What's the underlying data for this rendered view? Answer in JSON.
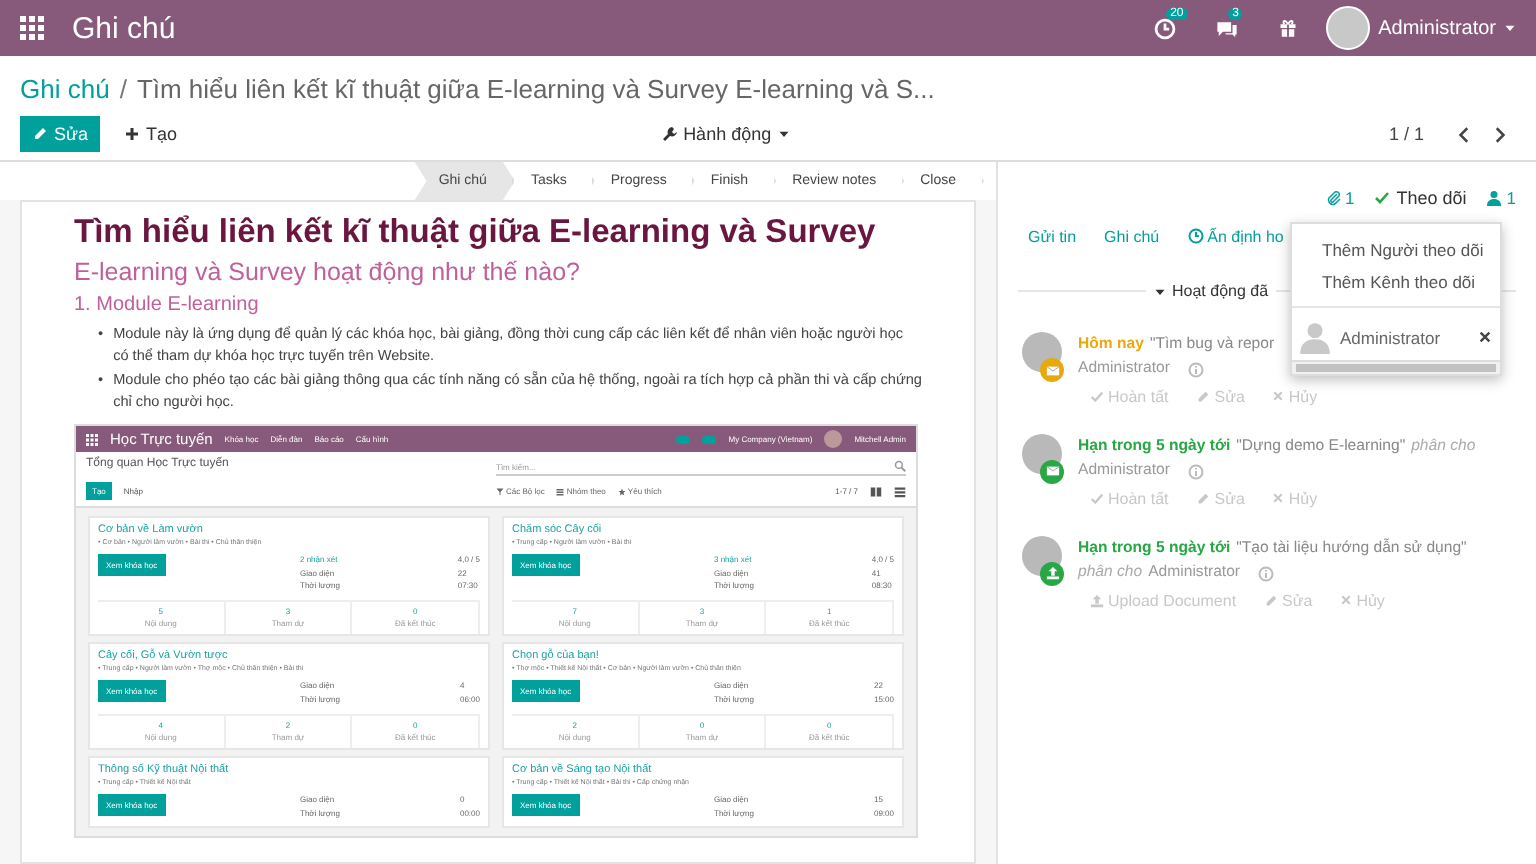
{
  "topbar": {
    "app_title": "Ghi chú",
    "activity_count": "20",
    "message_count": "3",
    "user": "Administrator"
  },
  "breadcrumb": {
    "parent": "Ghi chú",
    "separator": "/",
    "current": "Tìm hiểu liên kết kĩ thuật giữa E-learning và Survey E-learning và S..."
  },
  "toolbar": {
    "edit": "Sửa",
    "create": "Tạo",
    "action": "Hành động",
    "pager": "1 / 1"
  },
  "stages": [
    {
      "label": "Ghi chú",
      "selected": true
    },
    {
      "label": "Tasks",
      "selected": false
    },
    {
      "label": "Progress",
      "selected": false
    },
    {
      "label": "Finish",
      "selected": false
    },
    {
      "label": "Review notes",
      "selected": false
    },
    {
      "label": "Close",
      "selected": false
    }
  ],
  "document": {
    "title": "Tìm hiểu liên kết kĩ thuật giữa E-learning và Survey",
    "subtitle": "E-learning và Survey hoạt động như thế nào?",
    "section": "1. Module E-learning",
    "bullets": [
      {
        "marker": "•",
        "text": "Module này là ứng dụng để quản lý các khóa học, bài giảng, đồng thời cung cấp các liên kết để nhân viên hoặc người học có thể tham dự khóa học trực tuyến trên Website."
      },
      {
        "marker": "•",
        "text": "Module cho phéo tạo các bài giảng thông qua các tính năng có sẵn của hệ thống, ngoài ra tích hợp cả phần thi và cấp chứng chỉ cho người học."
      }
    ],
    "screenshot": {
      "app": "Học Trực tuyến",
      "menu": [
        "Khóa học",
        "Diễn đàn",
        "Báo cáo",
        "Cấu hình"
      ],
      "company": "My Company (Vietnam)",
      "user": "Mitchell Admin",
      "heading": "Tổng quan Học Trực tuyến",
      "search_placeholder": "Tìm kiếm...",
      "create": "Tạo",
      "import": "Nhập",
      "filters": [
        "Các Bộ lọc",
        "Nhóm theo",
        "Yêu thích"
      ],
      "pager": "1-7 / 7",
      "courses": [
        {
          "title": "Cơ bản về Làm vườn",
          "tags": "• Cơ bản • Người làm vườn • Bài thi • Chủ thân thiện",
          "button": "Xem khóa học",
          "reviews": "2 nhận xét",
          "rating": "4,0 / 5",
          "stats": [
            {
              "label": "Giao diện",
              "value": "22"
            },
            {
              "label": "Thời lượng",
              "value": "07:30"
            }
          ],
          "counts": [
            {
              "value": "5",
              "label": "Nội dung"
            },
            {
              "value": "3",
              "label": "Tham dự"
            },
            {
              "value": "0",
              "label": "Đã kết thúc"
            }
          ]
        },
        {
          "title": "Chăm sóc Cây cối",
          "tags": "• Trung cấp • Người làm vườn • Bài thi",
          "button": "Xem khóa học",
          "reviews": "3 nhận xét",
          "rating": "4,0 / 5",
          "stats": [
            {
              "label": "Giao diện",
              "value": "41"
            },
            {
              "label": "Thời lượng",
              "value": "08:30"
            }
          ],
          "counts": [
            {
              "value": "7",
              "label": "Nội dung"
            },
            {
              "value": "3",
              "label": "Tham dự"
            },
            {
              "value": "1",
              "label": "Đã kết thúc"
            }
          ]
        },
        {
          "title": "Cây cối, Gỗ và Vườn tược",
          "tags": "• Trung cấp • Người làm vườn • Thợ mộc • Chủ thân thiện • Bài thi",
          "button": "Xem khóa học",
          "stats": [
            {
              "label": "Giao diện",
              "value": "4"
            },
            {
              "label": "Thời lượng",
              "value": "06:00"
            }
          ],
          "counts": [
            {
              "value": "4",
              "label": "Nội dung"
            },
            {
              "value": "2",
              "label": "Tham dự"
            },
            {
              "value": "0",
              "label": "Đã kết thúc"
            }
          ]
        },
        {
          "title": "Chọn gỗ của bạn!",
          "tags": "• Thợ mộc • Thiết kế Nội thất • Cơ bản • Người làm vườn • Chủ thân thiện",
          "button": "Xem khóa học",
          "stats": [
            {
              "label": "Giao diện",
              "value": "22"
            },
            {
              "label": "Thời lượng",
              "value": "15:00"
            }
          ],
          "counts": [
            {
              "value": "2",
              "label": "Nội dung"
            },
            {
              "value": "0",
              "label": "Tham dự"
            },
            {
              "value": "0",
              "label": "Đã kết thúc"
            }
          ]
        },
        {
          "title": "Thông số Kỹ thuật Nội thất",
          "tags": "• Trung cấp • Thiết kế Nội thất",
          "button": "Xem khóa học",
          "stats": [
            {
              "label": "Giao diện",
              "value": "0"
            },
            {
              "label": "Thời lượng",
              "value": "00:00"
            }
          ]
        },
        {
          "title": "Cơ bản về Sáng tạo Nội thất",
          "tags": "• Trung cấp • Thiết kế Nội thất • Bài thi • Cấp chứng nhận",
          "button": "Xem khóa học",
          "stats": [
            {
              "label": "Giao diện",
              "value": "15"
            },
            {
              "label": "Thời lượng",
              "value": "09:00"
            }
          ]
        }
      ]
    }
  },
  "chatter": {
    "attachments": "1",
    "follow": "Theo dõi",
    "followers": "1",
    "tabs": [
      {
        "label": "Gửi tin",
        "kind": "text"
      },
      {
        "label": "Ghi chú",
        "kind": "text"
      },
      {
        "label": "Ấn định ho",
        "kind": "clock"
      }
    ],
    "activity_header": "Hoạt động đã",
    "activities": [
      {
        "due": "Hôm nay",
        "color": "#e8a90c",
        "kind": "mail",
        "summary": "\"Tìm bug và repor",
        "assignee": "Administrator",
        "actions": [
          {
            "label": "Hoàn tất",
            "kind": "done"
          },
          {
            "label": "Sửa",
            "kind": "edit"
          },
          {
            "label": "Hủy",
            "kind": "cancel"
          }
        ]
      },
      {
        "due": "Hạn trong 5 ngày tới",
        "color": "#28a745",
        "kind": "mail",
        "summary": "\"Dựng demo E-learning\"",
        "suffix": "phân cho",
        "assignee": "Administrator",
        "actions": [
          {
            "label": "Hoàn tất",
            "kind": "done"
          },
          {
            "label": "Sửa",
            "kind": "edit"
          },
          {
            "label": "Hủy",
            "kind": "cancel"
          }
        ]
      },
      {
        "due": "Hạn trong 5 ngày tới",
        "color": "#28a745",
        "kind": "upload",
        "summary": "\"Tạo tài liệu hướng dẫn sử dụng\"",
        "prefix": "phân cho",
        "assignee": "Administrator",
        "actions": [
          {
            "label": "Upload Document",
            "kind": "upload"
          },
          {
            "label": "Sửa",
            "kind": "edit"
          },
          {
            "label": "Hủy",
            "kind": "cancel"
          }
        ]
      }
    ],
    "follower_menu": {
      "items": [
        "Thêm Người theo dõi",
        "Thêm Kênh theo dõi"
      ],
      "followers": [
        "Administrator"
      ]
    }
  }
}
